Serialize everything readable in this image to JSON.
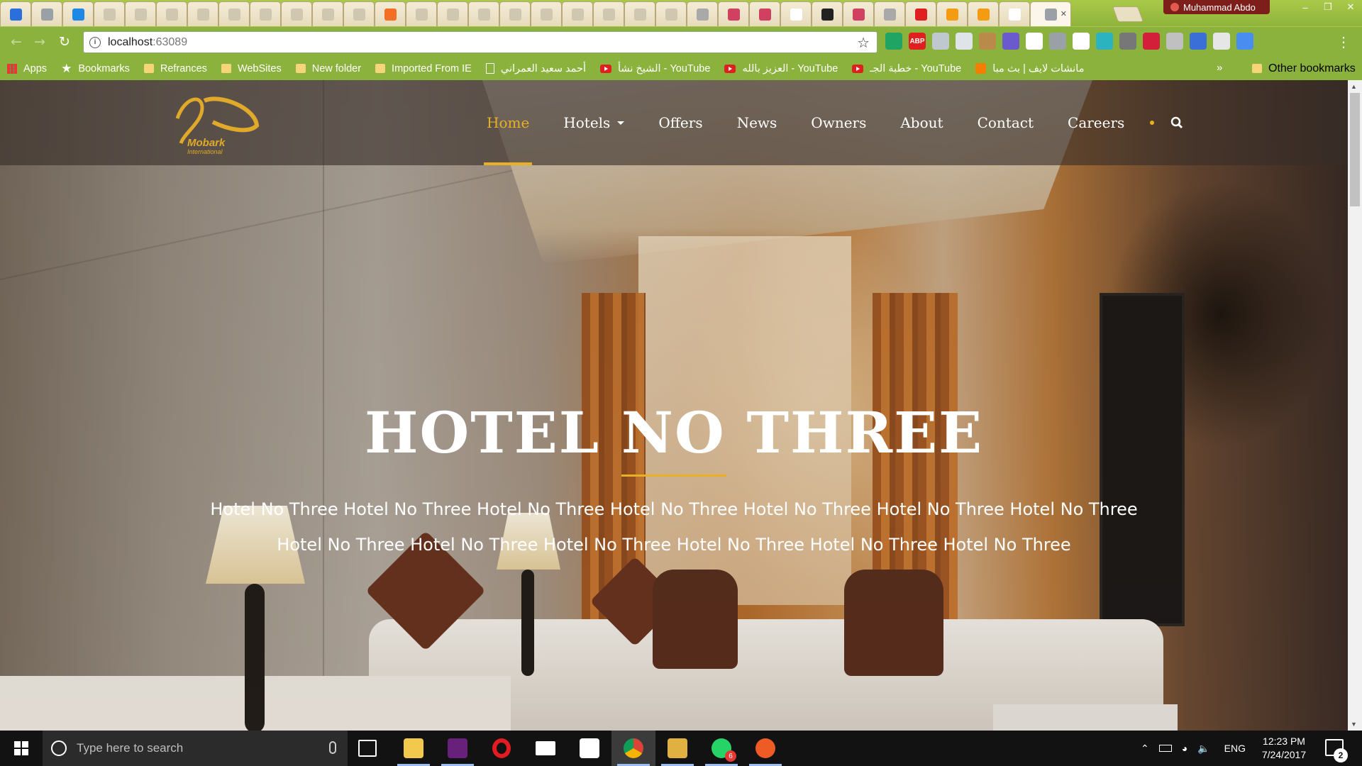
{
  "browser": {
    "profile_name": "Muhammad Abdo",
    "url_host": "localhost",
    "url_port": ":63089",
    "tabs": [
      {
        "icon": "outlook-icon",
        "color": "#2a6fdb"
      },
      {
        "icon": "code-icon",
        "color": "#9aa1a6"
      },
      {
        "icon": "messenger-icon",
        "color": "#1e88e5"
      },
      {
        "icon": "page-icon",
        "color": "#cfc7b0"
      },
      {
        "icon": "page-icon",
        "color": "#cfc7b0"
      },
      {
        "icon": "page-icon",
        "color": "#cfc7b0"
      },
      {
        "icon": "page-icon",
        "color": "#cfc7b0"
      },
      {
        "icon": "page-icon",
        "color": "#cfc7b0"
      },
      {
        "icon": "page-icon",
        "color": "#cfc7b0"
      },
      {
        "icon": "page-icon",
        "color": "#cfc7b0"
      },
      {
        "icon": "page-icon",
        "color": "#cfc7b0"
      },
      {
        "icon": "page-icon",
        "color": "#cfc7b0"
      },
      {
        "icon": "soundcloud-icon",
        "color": "#f26f23"
      },
      {
        "icon": "page-icon",
        "color": "#cfc7b0"
      },
      {
        "icon": "page-icon",
        "color": "#cfc7b0"
      },
      {
        "icon": "page-icon",
        "color": "#cfc7b0"
      },
      {
        "icon": "page-icon",
        "color": "#cfc7b0"
      },
      {
        "icon": "page-icon",
        "color": "#cfc7b0"
      },
      {
        "icon": "page-icon",
        "color": "#cfc7b0"
      },
      {
        "icon": "page-icon",
        "color": "#cfc7b0"
      },
      {
        "icon": "page-icon",
        "color": "#cfc7b0"
      },
      {
        "icon": "page-icon",
        "color": "#cfc7b0"
      },
      {
        "icon": "gear-icon",
        "color": "#a9a9a9"
      },
      {
        "icon": "jr-icon",
        "color": "#d04060"
      },
      {
        "icon": "jr-icon",
        "color": "#d04060"
      },
      {
        "icon": "page-icon",
        "color": "#ffffff"
      },
      {
        "icon": "github-icon",
        "color": "#222222"
      },
      {
        "icon": "jr-icon",
        "color": "#d04060"
      },
      {
        "icon": "gear-icon",
        "color": "#a9a9a9"
      },
      {
        "icon": "youtube-icon",
        "color": "#e02020"
      },
      {
        "icon": "pencil-icon",
        "color": "#f39c12"
      },
      {
        "icon": "pencil-icon",
        "color": "#f39c12"
      },
      {
        "icon": "page-icon",
        "color": "#ffffff"
      },
      {
        "icon": "image-icon",
        "color": "#9aa1a6",
        "active": true
      }
    ],
    "bookmarks": [
      {
        "label": "Apps",
        "type": "apps"
      },
      {
        "label": "Bookmarks",
        "type": "star"
      },
      {
        "label": "Refrances",
        "type": "folder"
      },
      {
        "label": "WebSites",
        "type": "folder"
      },
      {
        "label": "New folder",
        "type": "folder"
      },
      {
        "label": "Imported From IE",
        "type": "folder"
      },
      {
        "label": "أحمد سعيد العمراني",
        "type": "page"
      },
      {
        "label": "الشيخ نشأ - YouTube",
        "type": "yt"
      },
      {
        "label": "العزيز بالله - YouTube",
        "type": "yt"
      },
      {
        "label": "خطبة الجـ - YouTube",
        "type": "yt"
      },
      {
        "label": "مانشات لايف | بث مبا",
        "type": "blog"
      }
    ],
    "bookmarks_more": "»",
    "other_bookmarks": "Other bookmarks"
  },
  "site": {
    "logo_name": "Mobark",
    "logo_sub": "International",
    "nav": [
      {
        "label": "Home",
        "active": true
      },
      {
        "label": "Hotels",
        "dropdown": true
      },
      {
        "label": "Offers"
      },
      {
        "label": "News"
      },
      {
        "label": "Owners"
      },
      {
        "label": "About"
      },
      {
        "label": "Contact"
      },
      {
        "label": "Careers"
      }
    ],
    "hero_title": "HOTEL NO THREE",
    "hero_description": "Hotel No Three Hotel No Three Hotel No Three Hotel No Three Hotel No Three Hotel No Three Hotel No Three Hotel No Three Hotel No Three Hotel No Three Hotel No Three Hotel No Three Hotel No Three",
    "accent_color": "#e8b024"
  },
  "taskbar": {
    "search_placeholder": "Type here to search",
    "apps": [
      {
        "icon": "file-explorer-icon",
        "color": "#f2c94c",
        "running": true
      },
      {
        "icon": "visual-studio-icon",
        "color": "#68217a",
        "running": true
      },
      {
        "icon": "opera-icon",
        "color": "#e31b23",
        "running": false
      },
      {
        "icon": "mail-icon",
        "color": "#ffffff",
        "running": false
      },
      {
        "icon": "slack-icon",
        "color": "#ffffff",
        "running": false
      },
      {
        "icon": "chrome-icon",
        "color": "#4caf50",
        "running": true,
        "active": true
      },
      {
        "icon": "tools-icon",
        "color": "#e0b040",
        "running": true
      },
      {
        "icon": "whatsapp-icon",
        "color": "#25d366",
        "running": true,
        "badge": "6"
      },
      {
        "icon": "postman-icon",
        "color": "#ef5b25",
        "running": true
      }
    ],
    "language": "ENG",
    "time": "12:23 PM",
    "date": "7/24/2017",
    "notifications": "2"
  }
}
